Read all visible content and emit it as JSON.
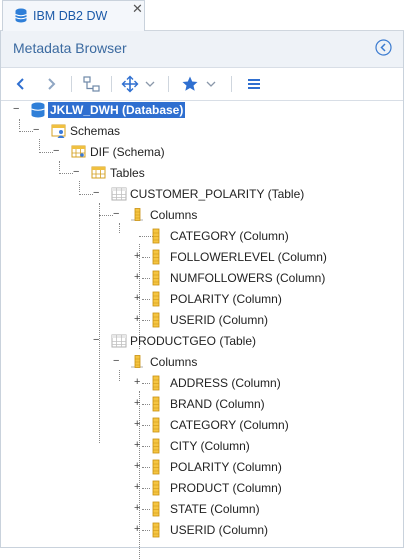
{
  "tab": {
    "title": "IBM DB2 DW",
    "close": "✕"
  },
  "header": {
    "title": "Metadata Browser"
  },
  "tree": {
    "database": "JKLW_DWH (Database)",
    "schemas": "Schemas",
    "schema": "DIF (Schema)",
    "tables": "Tables",
    "table1": {
      "name": "CUSTOMER_POLARITY (Table)",
      "columns_label": "Columns",
      "columns": [
        "CATEGORY (Column)",
        "FOLLOWERLEVEL (Column)",
        "NUMFOLLOWERS (Column)",
        "POLARITY (Column)",
        "USERID (Column)"
      ]
    },
    "table2": {
      "name": "PRODUCTGEO (Table)",
      "columns_label": "Columns",
      "columns": [
        "ADDRESS (Column)",
        "BRAND (Column)",
        "CATEGORY (Column)",
        "CITY (Column)",
        "POLARITY (Column)",
        "PRODUCT (Column)",
        "STATE (Column)",
        "USERID (Column)"
      ]
    }
  },
  "colors": {
    "accent": "#2f6fd0",
    "title": "#3b6aa0",
    "column_icon": "#e0a020"
  }
}
